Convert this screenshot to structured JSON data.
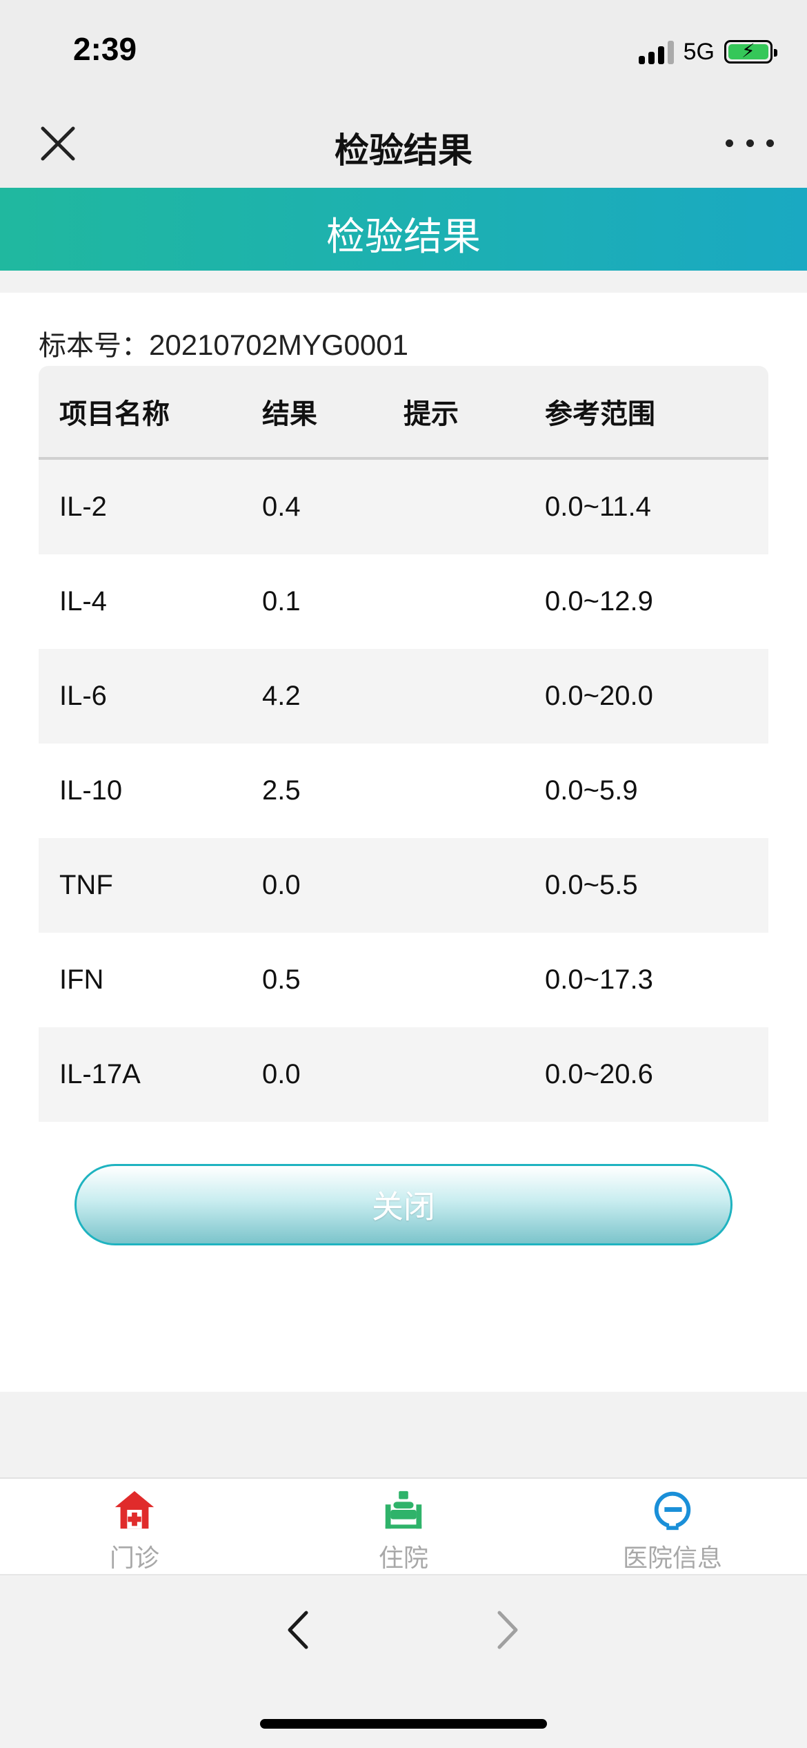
{
  "status_bar": {
    "time": "2:39",
    "network": "5G",
    "battery_color": "#35c759"
  },
  "nav": {
    "title": "检验结果",
    "close_icon": "close-icon",
    "more_icon": "more-icon"
  },
  "banner": {
    "title": "检验结果",
    "gradient": [
      "#20b89f",
      "#1aa9c2"
    ]
  },
  "sample": {
    "label": "标本号：",
    "value": "20210702MYG0001"
  },
  "table": {
    "headers": [
      "项目名称",
      "结果",
      "提示",
      "参考范围"
    ],
    "rows": [
      {
        "name": "IL-2",
        "result": "0.4",
        "hint": "",
        "range": "0.0~11.4"
      },
      {
        "name": "IL-4",
        "result": "0.1",
        "hint": "",
        "range": "0.0~12.9"
      },
      {
        "name": "IL-6",
        "result": "4.2",
        "hint": "",
        "range": "0.0~20.0"
      },
      {
        "name": "IL-10",
        "result": "2.5",
        "hint": "",
        "range": "0.0~5.9"
      },
      {
        "name": "TNF",
        "result": "0.0",
        "hint": "",
        "range": "0.0~5.5"
      },
      {
        "name": "IFN",
        "result": "0.5",
        "hint": "",
        "range": "0.0~17.3"
      },
      {
        "name": "IL-17A",
        "result": "0.0",
        "hint": "",
        "range": "0.0~20.6"
      }
    ]
  },
  "close_button": {
    "label": "关闭"
  },
  "tab_bar": {
    "items": [
      {
        "label": "门诊",
        "icon": "outpatient-icon",
        "color": "#e02b2b"
      },
      {
        "label": "住院",
        "icon": "inpatient-icon",
        "color": "#2fb36a"
      },
      {
        "label": "医院信息",
        "icon": "hospital-info-icon",
        "color": "#1a8fd8"
      }
    ]
  },
  "browser": {
    "back_icon": "back-arrow-icon",
    "forward_icon": "forward-arrow-icon"
  }
}
